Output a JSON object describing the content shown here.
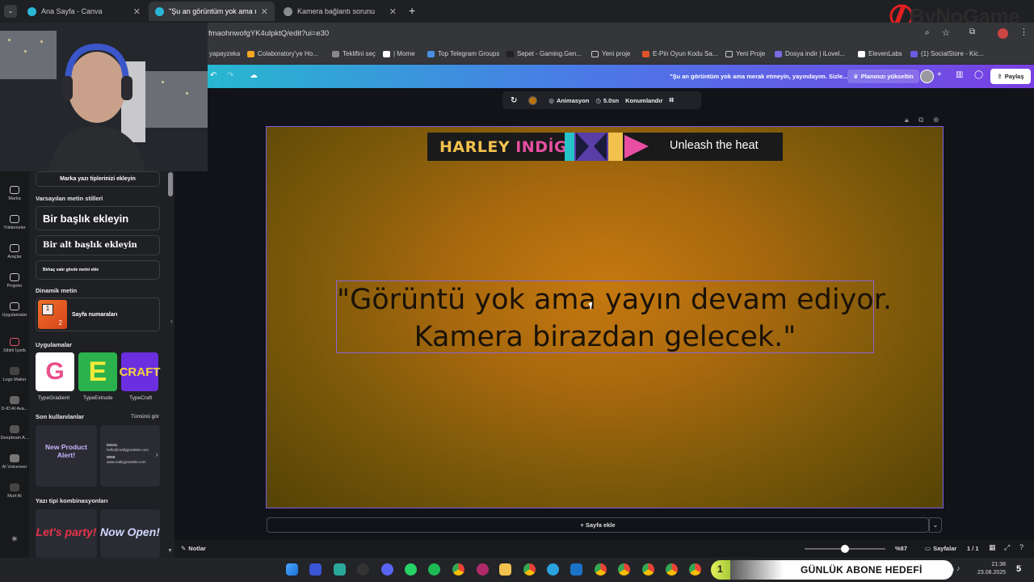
{
  "tabs": [
    {
      "title": "Ana Sayfa - Canva"
    },
    {
      "title": "\"Şu an görüntüm yok ama mer"
    },
    {
      "title": "Kamera bağlantı sorunu"
    }
  ],
  "address": {
    "url": "fmaohnwofgYK4ulpktQ/edit?ui=e30"
  },
  "bookmarks": [
    "yapayzeka",
    "Colaboratory'ye Ho...",
    "Teklifini seç",
    "| Mome",
    "Top Telegram Groups",
    "Sepet - Gaming.Gen...",
    "Yeni proje",
    "E-Pin Oyun Kodu Sa...",
    "Yeni Proje",
    "Dosya indir | iLovel...",
    "ElevenLabs",
    "(1) SocialStore - Kic..."
  ],
  "watermark": {
    "brand": "ByNoGame"
  },
  "canva_header": {
    "design_title": "\"Şu an görüntüm yok ama merak etmeyin, yayındayım. Sizle...",
    "upgrade_label": "Planınızı yükseltin",
    "share_label": "Paylaş"
  },
  "rail": [
    {
      "label": "Marka"
    },
    {
      "label": "Yüklemeler"
    },
    {
      "label": "Araçlar"
    },
    {
      "label": "Projeler"
    },
    {
      "label": "Uygulamalar"
    },
    {
      "label": "Sihirli İçerik"
    },
    {
      "label": "Logo Maker"
    },
    {
      "label": "D-ID AI Ava..."
    },
    {
      "label": "Deepbrain A..."
    },
    {
      "label": "AI Voiceover"
    },
    {
      "label": "Murf AI"
    }
  ],
  "panel": {
    "brand_fonts_button": "Marka yazı tiplerinizi ekleyin",
    "default_styles_heading": "Varsayılan metin stilleri",
    "heading_button": "Bir başlık ekleyin",
    "subheading_button": "Bir alt başlık ekleyin",
    "body_button": "Birkaç satır gövde metni ekle",
    "dynamic_heading": "Dinamik metin",
    "page_numbers_label": "Sayfa numaraları",
    "apps_heading": "Uygulamalar",
    "apps": [
      {
        "label": "TypeGradient"
      },
      {
        "label": "TypeExtrude"
      },
      {
        "label": "TypeCraft"
      }
    ],
    "recent_heading": "Son kullanılanlar",
    "see_all": "Tümünü gör",
    "recent_cards": [
      {
        "line1": "New Product",
        "line2": "Alert!"
      },
      {
        "email_label": "EMAIL",
        "email": "hello@reallygreatsite.com",
        "web_label": "WEB",
        "web": "www.reallygreatsite.com"
      }
    ],
    "font_combos_heading": "Yazı tipi kombinasyonları",
    "combo_cards": [
      {
        "text": "Let's party!"
      },
      {
        "text": "Now Open!"
      }
    ]
  },
  "context_toolbar": {
    "animate_label": "Animasyon",
    "duration_label": "5.0sn",
    "position_label": "Konumlandır",
    "color": "#b8720f"
  },
  "canvas": {
    "banner_brand_a": "HARLEY",
    "banner_brand_b": "INDİGO",
    "banner_tagline": "Unleash the heat",
    "quote_line1": "\"Görüntü yok ama yayın devam ediyor.",
    "quote_line2": "Kamera birazdan gelecek.\""
  },
  "add_page_label": "+ Sayfa ekle",
  "bottom": {
    "notes_label": "Notlar",
    "zoom_label": "%87",
    "zoom_value": 87,
    "pages_label": "Sayfalar",
    "page_count": "1 / 1"
  },
  "taskbar": {
    "goal_count": "1",
    "goal_label": "GÜNLÜK ABONE HEDEFİ",
    "goal_progress": 0.08,
    "time": "21:38",
    "date": "23.08.2025",
    "notif_badge": "5"
  },
  "colors": {
    "canva_accent": "#7a3fe4",
    "canvas_bg": "#b8720f",
    "quote_text": "#1a1207"
  }
}
